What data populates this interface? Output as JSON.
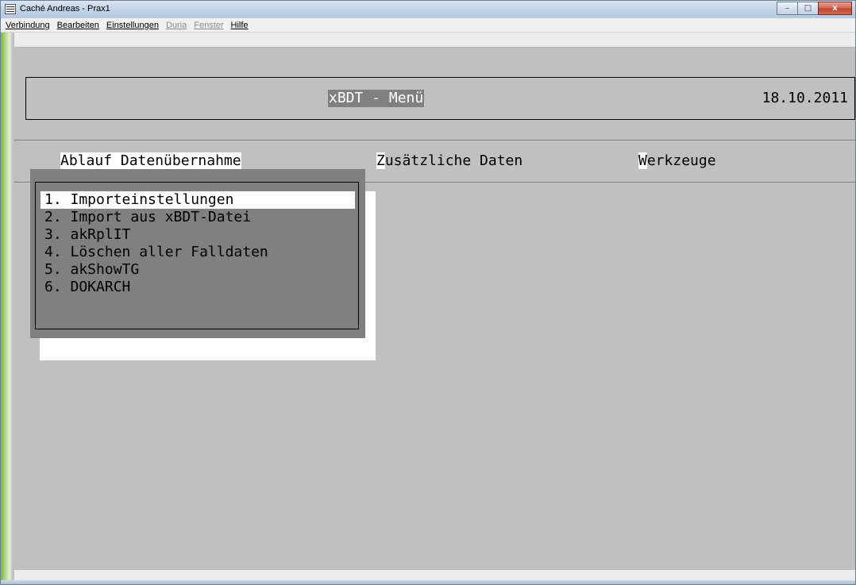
{
  "window": {
    "title": "Caché Andreas - Prax1",
    "controls": {
      "minimize": "–",
      "maximize": "□",
      "close": "x"
    }
  },
  "menubar": {
    "items": [
      {
        "label": "Verbindung",
        "enabled": true
      },
      {
        "label": "Bearbeiten",
        "enabled": true
      },
      {
        "label": "Einstellungen",
        "enabled": true
      },
      {
        "label": "Duria",
        "enabled": false
      },
      {
        "label": "Fenster",
        "enabled": false
      },
      {
        "label": "Hilfe",
        "enabled": true
      }
    ]
  },
  "header": {
    "title": "xBDT - Menü",
    "date": "18.10.2011"
  },
  "top_menu": {
    "items": [
      {
        "hot": "A",
        "rest": "blauf Datenübernahme",
        "active": true
      },
      {
        "hot": "Z",
        "rest": "usätzliche Daten",
        "active": false
      },
      {
        "hot": "W",
        "rest": "erkzeuge",
        "active": false
      }
    ]
  },
  "dropdown": {
    "selected_index": 0,
    "items": [
      "1. Importeinstellungen",
      "2. Import aus xBDT-Datei",
      "3. akRplIT",
      "4. Löschen aller Falldaten",
      "5. akShowTG",
      "6. DOKARCH"
    ]
  }
}
